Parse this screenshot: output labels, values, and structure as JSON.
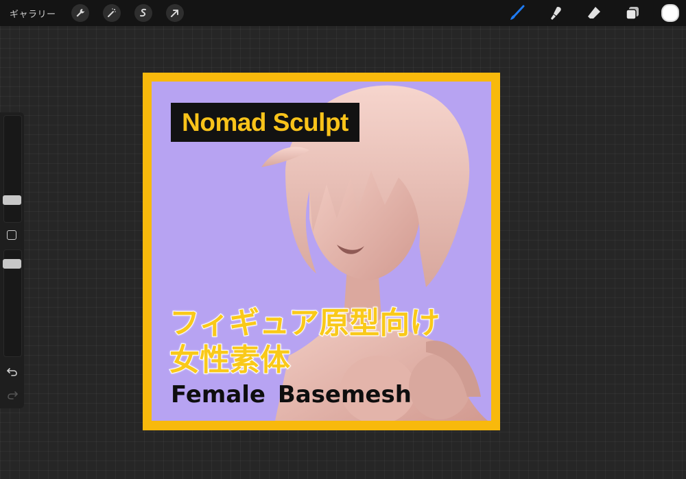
{
  "toolbar": {
    "gallery_label": "ギャラリー",
    "left_tools": [
      "wrench-icon",
      "magic-wand-icon",
      "selection-icon",
      "transform-arrow-icon"
    ],
    "right_tools": [
      "brush-icon",
      "smudge-icon",
      "eraser-icon",
      "layers-icon"
    ],
    "active_tool": "brush-icon",
    "accent_color": "#1f7bf2",
    "current_color": "#ffffff"
  },
  "sidebar": {
    "brush_size_level": 0.75,
    "opacity_level": 0.65,
    "icons": [
      "modify-square-icon",
      "undo-icon",
      "redo-icon"
    ]
  },
  "artwork": {
    "title": "Nomad Sculpt",
    "jp_line1": "フィギュア原型向け",
    "jp_line2": "女性素体",
    "en_line": "Female Basemesh",
    "frame_color": "#f8b90c",
    "background_color": "#b7a3f2",
    "figure_color": "#e8b8ad"
  }
}
